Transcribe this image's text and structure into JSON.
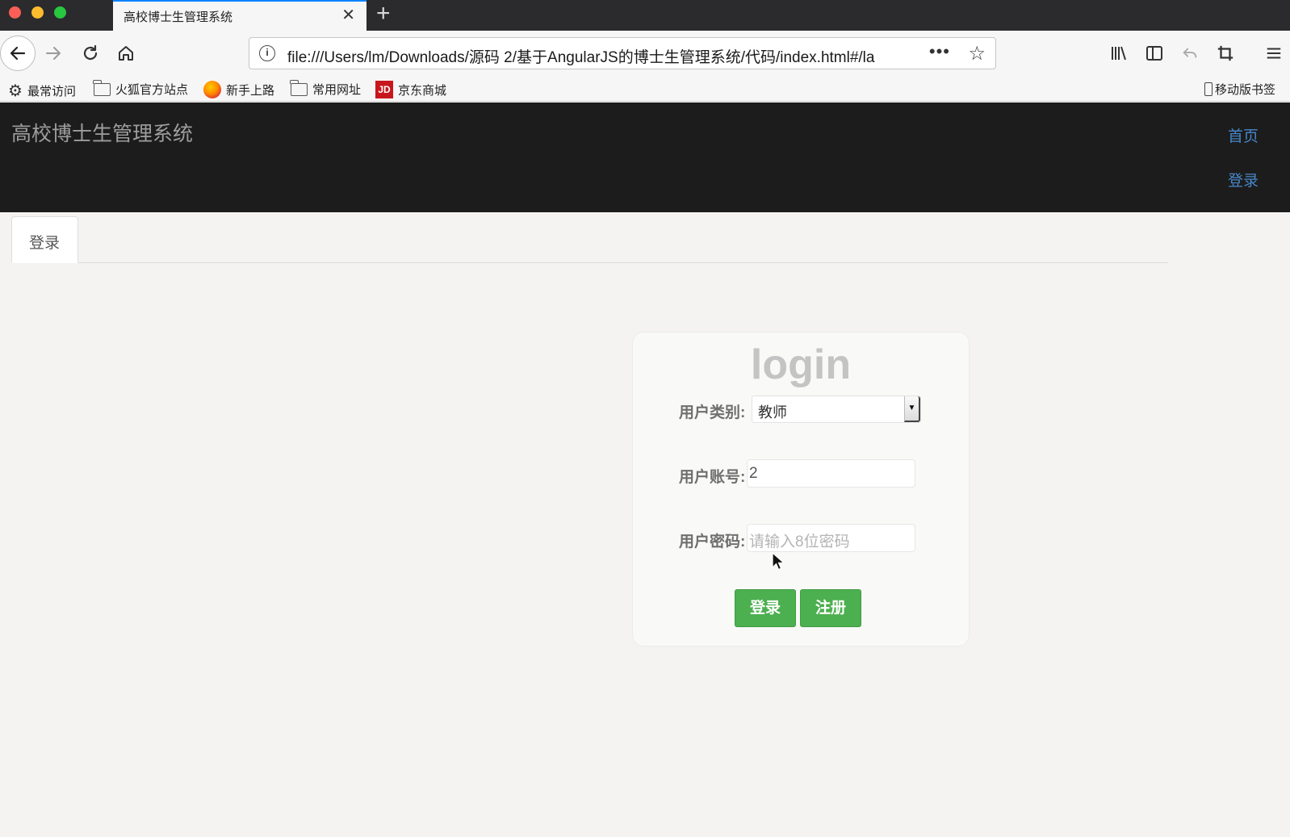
{
  "browser": {
    "tab_title": "高校博士生管理系统",
    "tab_close": "✕",
    "new_tab": "+",
    "url": "file:///Users/lm/Downloads/源码 2/基于AngularJS的博士生管理系统/代码/index.html#/la",
    "url_more": "•••",
    "bookmarks": [
      {
        "label": "最常访问",
        "icon": "gear-icon"
      },
      {
        "label": "火狐官方站点",
        "icon": "folder-icon"
      },
      {
        "label": "新手上路",
        "icon": "firefox-icon"
      },
      {
        "label": "常用网址",
        "icon": "folder-icon"
      },
      {
        "label": "京东商城",
        "icon": "jd-icon"
      }
    ],
    "jd_mark": "JD",
    "mobile_bookmarks": "移动版书签"
  },
  "app": {
    "brand": "高校博士生管理系统",
    "nav": {
      "home": "首页",
      "login": "登录"
    },
    "tabs": [
      {
        "label": "登录",
        "active": true
      }
    ]
  },
  "login_form": {
    "title": "login",
    "user_type_label": "用户类别:",
    "user_type_value": "教师",
    "account_label": "用户账号:",
    "account_value": "2",
    "password_label": "用户密码:",
    "password_placeholder": "请输入8位密码",
    "login_button": "登录",
    "register_button": "注册"
  },
  "colors": {
    "header_bg": "#1c1c1c",
    "nav_link": "#4787c9",
    "button_green": "#4caf50",
    "tab_accent": "#0a84ff"
  }
}
